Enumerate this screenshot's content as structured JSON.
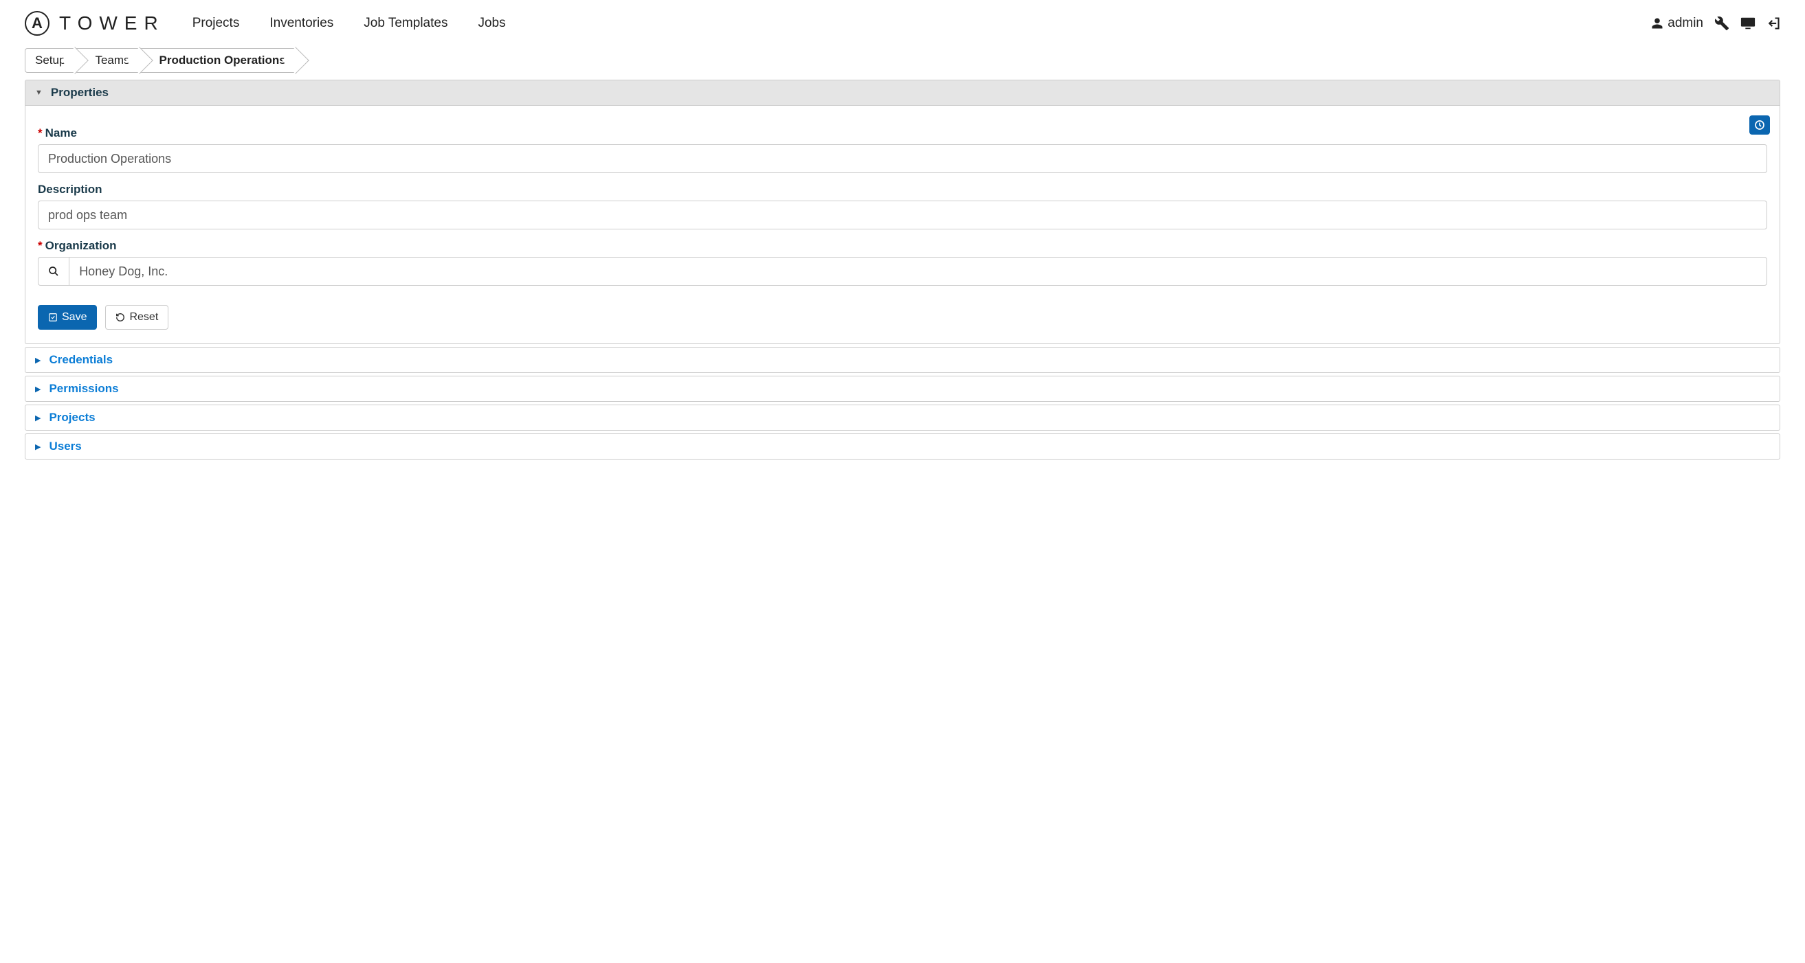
{
  "brand": {
    "logo_letter": "A",
    "logo_text": "TOWER"
  },
  "nav": {
    "projects": "Projects",
    "inventories": "Inventories",
    "job_templates": "Job Templates",
    "jobs": "Jobs"
  },
  "user": {
    "name": "admin"
  },
  "breadcrumb": {
    "items": [
      {
        "label": "Setup"
      },
      {
        "label": "Teams"
      },
      {
        "label": "Production Operations",
        "active": true
      }
    ]
  },
  "properties": {
    "header": "Properties",
    "name_label": "Name",
    "name_value": "Production Operations",
    "description_label": "Description",
    "description_value": "prod ops team",
    "organization_label": "Organization",
    "organization_value": "Honey Dog, Inc.",
    "save_label": "Save",
    "reset_label": "Reset"
  },
  "sections": {
    "credentials": "Credentials",
    "permissions": "Permissions",
    "projects": "Projects",
    "users": "Users"
  }
}
